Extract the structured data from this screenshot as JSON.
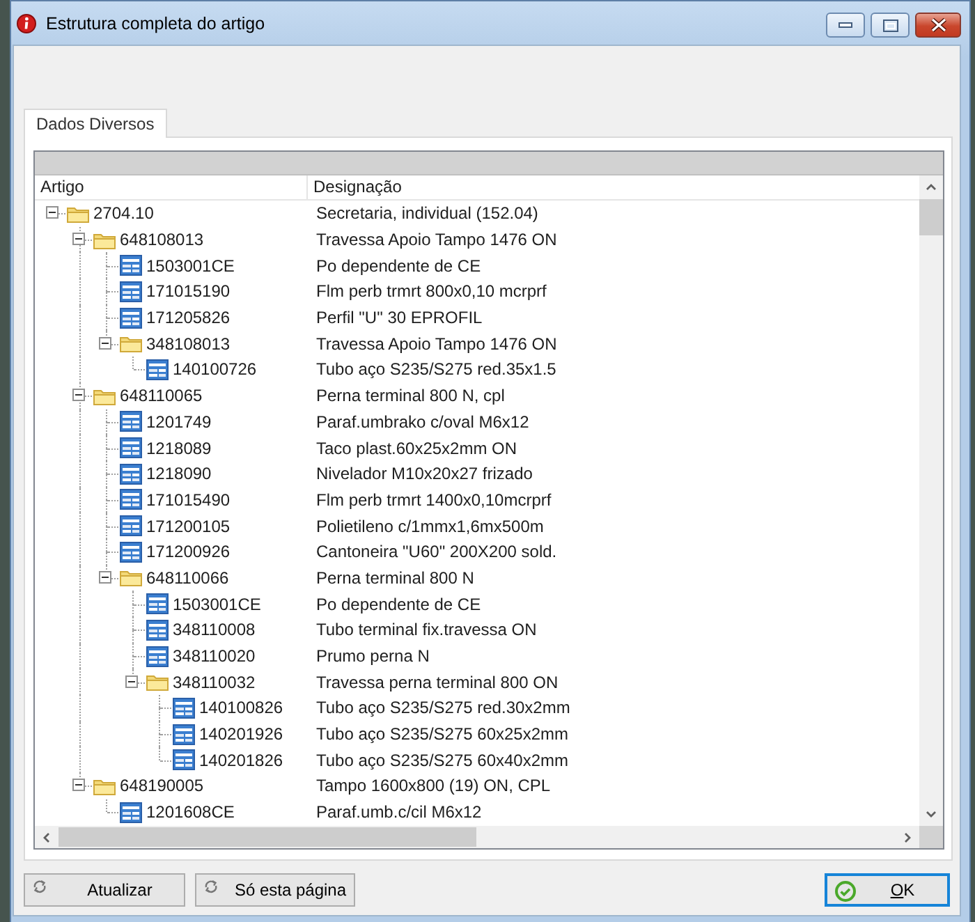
{
  "window": {
    "title": "Estrutura completa do artigo"
  },
  "tabs": [
    {
      "label": "Dados Diversos",
      "selected": true
    }
  ],
  "tree": {
    "columns": [
      "Artigo",
      "Designação"
    ],
    "items": [
      {
        "code": "2704.10",
        "description": "Secretaria, individual (152.04)",
        "expanded": true,
        "children": [
          {
            "code": "648108013",
            "description": "Travessa Apoio Tampo 1476 ON",
            "expanded": true,
            "children": [
              {
                "code": "1503001CE",
                "description": "Po dependente de CE"
              },
              {
                "code": "171015190",
                "description": "Flm perb trmrt 800x0,10 mcrprf"
              },
              {
                "code": "171205826",
                "description": "Perfil \"U\" 30 EPROFIL"
              },
              {
                "code": "348108013",
                "description": "Travessa Apoio Tampo 1476 ON",
                "expanded": true,
                "children": [
                  {
                    "code": "140100726",
                    "description": "Tubo aço S235/S275 red.35x1.5"
                  }
                ]
              }
            ]
          },
          {
            "code": "648110065",
            "description": "Perna terminal 800 N, cpl",
            "expanded": true,
            "children": [
              {
                "code": "1201749",
                "description": "Paraf.umbrako c/oval M6x12"
              },
              {
                "code": "1218089",
                "description": "Taco plast.60x25x2mm ON"
              },
              {
                "code": "1218090",
                "description": "Nivelador M10x20x27 frizado"
              },
              {
                "code": "171015490",
                "description": "Flm perb trmrt 1400x0,10mcrprf"
              },
              {
                "code": "171200105",
                "description": "Polietileno c/1mmx1,6mx500m"
              },
              {
                "code": "171200926",
                "description": "Cantoneira \"U60\" 200X200 sold."
              },
              {
                "code": "648110066",
                "description": "Perna terminal 800 N",
                "expanded": true,
                "children": [
                  {
                    "code": "1503001CE",
                    "description": "Po dependente de CE"
                  },
                  {
                    "code": "348110008",
                    "description": "Tubo terminal fix.travessa ON"
                  },
                  {
                    "code": "348110020",
                    "description": "Prumo perna N"
                  },
                  {
                    "code": "348110032",
                    "description": "Travessa perna terminal 800 ON",
                    "expanded": true,
                    "children": [
                      {
                        "code": "140100826",
                        "description": "Tubo aço S235/S275 red.30x2mm"
                      },
                      {
                        "code": "140201926",
                        "description": "Tubo aço S235/S275 60x25x2mm"
                      },
                      {
                        "code": "140201826",
                        "description": "Tubo aço S235/S275 60x40x2mm"
                      }
                    ]
                  }
                ]
              }
            ]
          },
          {
            "code": "648190005",
            "description": "Tampo 1600x800 (19) ON, CPL",
            "expanded": true,
            "children": [
              {
                "code": "1201608CE",
                "description": "Paraf.umb.c/cil M6x12"
              }
            ]
          }
        ]
      }
    ]
  },
  "buttons": [
    {
      "label": "Atualizar",
      "kind": "refresh",
      "focused": false
    },
    {
      "label": "Só esta página",
      "kind": "refresh",
      "focused": false
    },
    {
      "label": "OK",
      "kind": "confirm",
      "focused": true
    }
  ]
}
